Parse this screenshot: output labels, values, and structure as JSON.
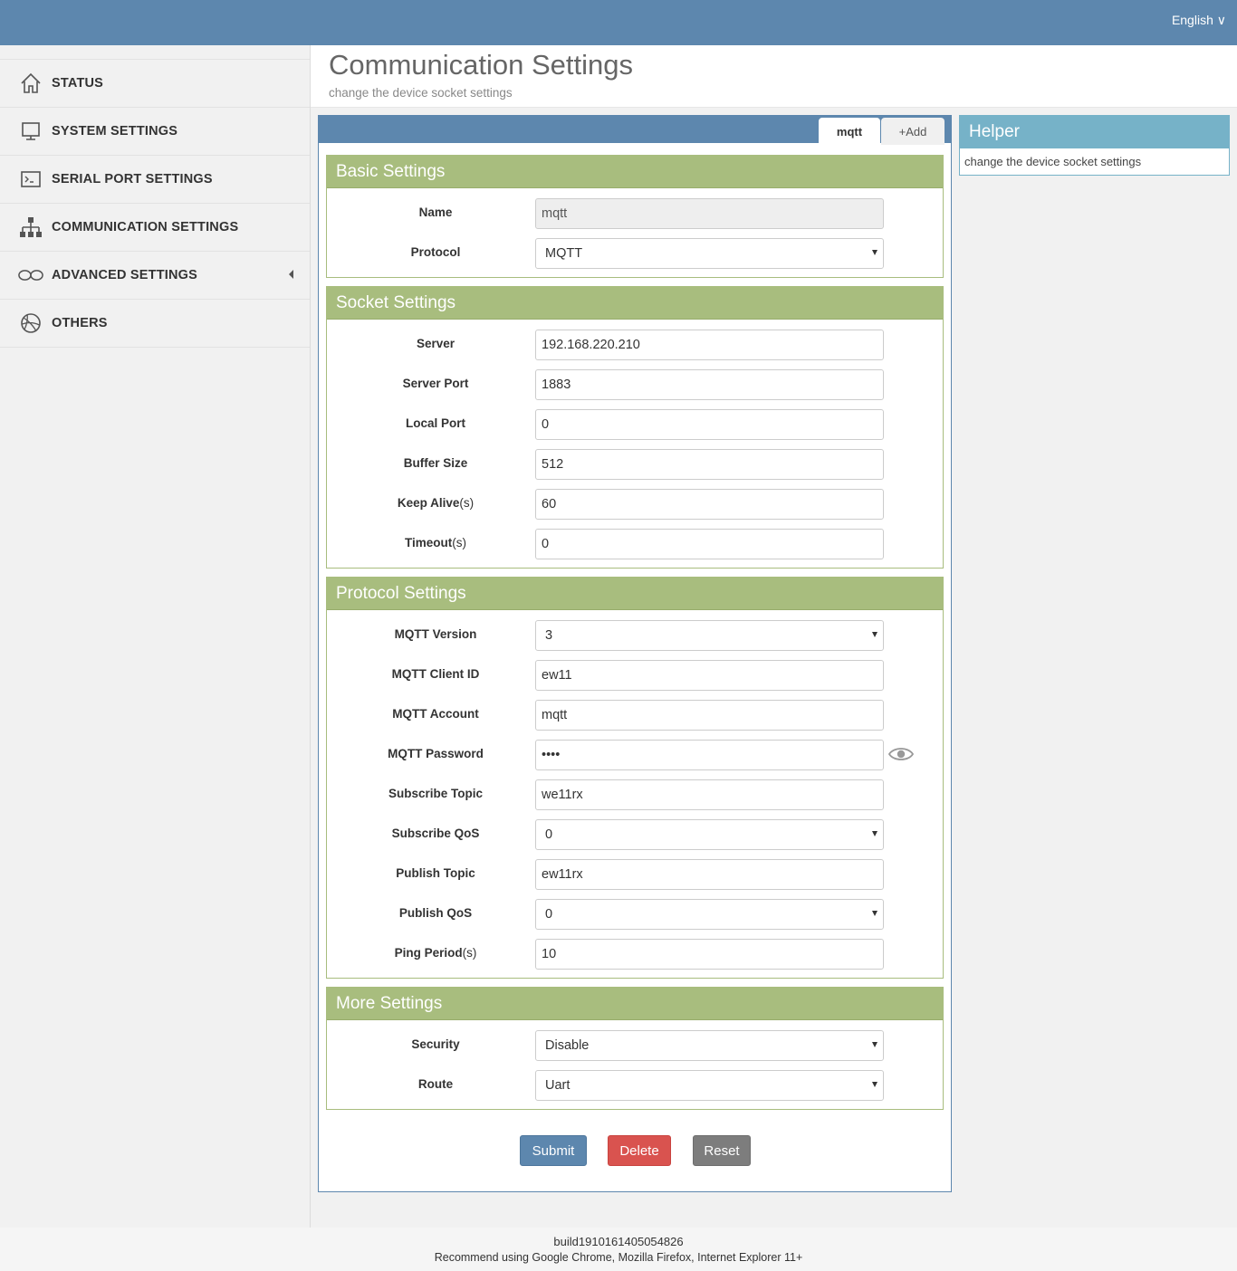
{
  "topbar": {
    "language": "English ∨"
  },
  "sidebar": {
    "items": [
      {
        "label": "STATUS",
        "icon": "home-icon"
      },
      {
        "label": "SYSTEM SETTINGS",
        "icon": "monitor-icon"
      },
      {
        "label": "SERIAL PORT SETTINGS",
        "icon": "terminal-icon"
      },
      {
        "label": "COMMUNICATION SETTINGS",
        "icon": "network-icon"
      },
      {
        "label": "ADVANCED SETTINGS",
        "icon": "infinity-icon"
      },
      {
        "label": "OTHERS",
        "icon": "globe-icon"
      }
    ]
  },
  "header": {
    "title": "Communication Settings",
    "subtitle": "change the device socket settings"
  },
  "tabs": {
    "active": "mqtt",
    "add": "+Add"
  },
  "basic": {
    "title": "Basic Settings",
    "name_label": "Name",
    "name_value": "mqtt",
    "protocol_label": "Protocol",
    "protocol_value": "MQTT"
  },
  "socket": {
    "title": "Socket Settings",
    "server_label": "Server",
    "server_value": "192.168.220.210",
    "server_port_label": "Server Port",
    "server_port_value": "1883",
    "local_port_label": "Local Port",
    "local_port_value": "0",
    "buffer_size_label": "Buffer Size",
    "buffer_size_value": "512",
    "keep_alive_label": "Keep Alive",
    "keep_alive_unit": "(s)",
    "keep_alive_value": "60",
    "timeout_label": "Timeout",
    "timeout_unit": "(s)",
    "timeout_value": "0"
  },
  "protocol": {
    "title": "Protocol Settings",
    "version_label": "MQTT Version",
    "version_value": "3",
    "client_id_label": "MQTT Client ID",
    "client_id_value": "ew11",
    "account_label": "MQTT Account",
    "account_value": "mqtt",
    "password_label": "MQTT Password",
    "password_value": "••••",
    "sub_topic_label": "Subscribe Topic",
    "sub_topic_value": "we11rx",
    "sub_qos_label": "Subscribe QoS",
    "sub_qos_value": "0",
    "pub_topic_label": "Publish Topic",
    "pub_topic_value": "ew11rx",
    "pub_qos_label": "Publish QoS",
    "pub_qos_value": "0",
    "ping_label": "Ping Period",
    "ping_unit": "(s)",
    "ping_value": "10"
  },
  "more": {
    "title": "More Settings",
    "security_label": "Security",
    "security_value": "Disable",
    "route_label": "Route",
    "route_value": "Uart"
  },
  "buttons": {
    "submit": "Submit",
    "delete": "Delete",
    "reset": "Reset"
  },
  "helper": {
    "title": "Helper",
    "text": "change the device socket settings"
  },
  "footer": {
    "build": "build1910161405054826",
    "recommend": "Recommend using Google Chrome, Mozilla Firefox, Internet Explorer 11+"
  },
  "colors": {
    "topbar": "#5d87ae",
    "section": "#a8bd7e",
    "helper": "#76b2c8",
    "delete": "#d9534f",
    "reset": "#7d7d7d"
  }
}
